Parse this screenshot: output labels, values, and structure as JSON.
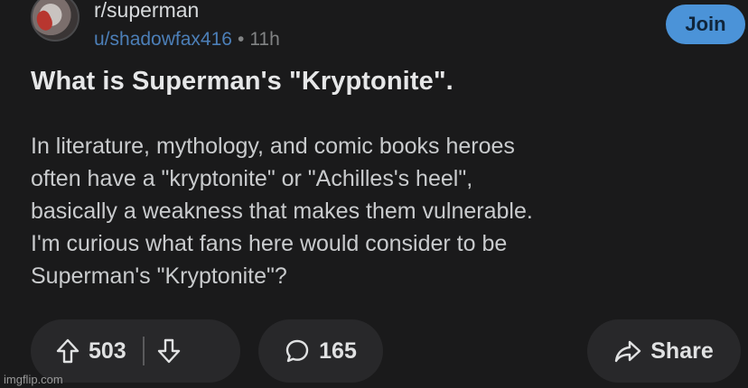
{
  "post": {
    "subreddit": "r/superman",
    "username": "u/shadowfax416",
    "separator": "•",
    "age": "11h",
    "join_label": "Join",
    "title": "What is Superman's \"Kryptonite\".",
    "body_lines": [
      "In literature, mythology, and comic books heroes",
      "often have a \"kryptonite\" or \"Achilles's heel\",",
      "basically a weakness that makes them vulnerable.",
      "I'm curious what fans here would consider to be",
      "Superman's \"Kryptonite\"?"
    ]
  },
  "actions": {
    "upvote_icon": "arrow-up-icon",
    "vote_count": "503",
    "downvote_icon": "arrow-down-icon",
    "comment_icon": "speech-bubble-icon",
    "comment_count": "165",
    "share_icon": "share-arrow-icon",
    "share_label": "Share"
  },
  "watermark": "imgflip.com",
  "colors": {
    "background": "#1a1a1b",
    "accent": "#4b93d8",
    "username": "#4c7fb8",
    "pill": "#28282a"
  }
}
